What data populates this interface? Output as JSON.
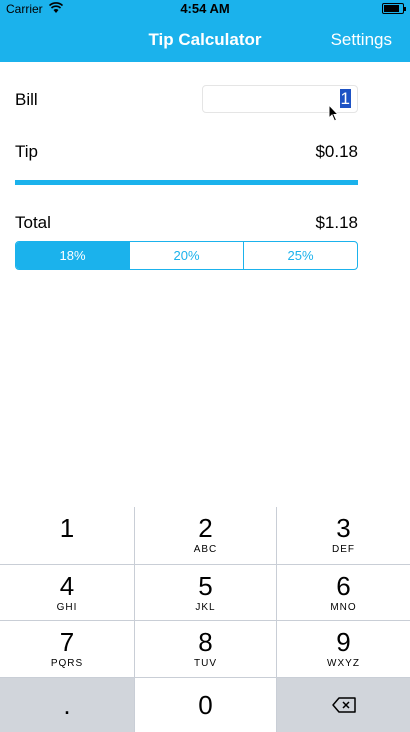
{
  "status_bar": {
    "carrier": "Carrier",
    "time": "4:54 AM"
  },
  "nav": {
    "title": "Tip Calculator",
    "settings": "Settings"
  },
  "bill": {
    "label": "Bill",
    "value": "1"
  },
  "tip": {
    "label": "Tip",
    "amount": "$0.18",
    "bar_fraction": 1.0
  },
  "total": {
    "label": "Total",
    "amount": "$1.18"
  },
  "tip_options": {
    "labels": [
      "18%",
      "20%",
      "25%"
    ],
    "selected_index": 0
  },
  "keypad": {
    "keys": [
      {
        "digit": "1",
        "letters": ""
      },
      {
        "digit": "2",
        "letters": "ABC"
      },
      {
        "digit": "3",
        "letters": "DEF"
      },
      {
        "digit": "4",
        "letters": "GHI"
      },
      {
        "digit": "5",
        "letters": "JKL"
      },
      {
        "digit": "6",
        "letters": "MNO"
      },
      {
        "digit": "7",
        "letters": "PQRS"
      },
      {
        "digit": "8",
        "letters": "TUV"
      },
      {
        "digit": "9",
        "letters": "WXYZ"
      },
      {
        "digit": ".",
        "letters": ""
      },
      {
        "digit": "0",
        "letters": ""
      }
    ]
  },
  "colors": {
    "accent": "#1bb2ec",
    "keypad_bg": "#c9ced6"
  }
}
